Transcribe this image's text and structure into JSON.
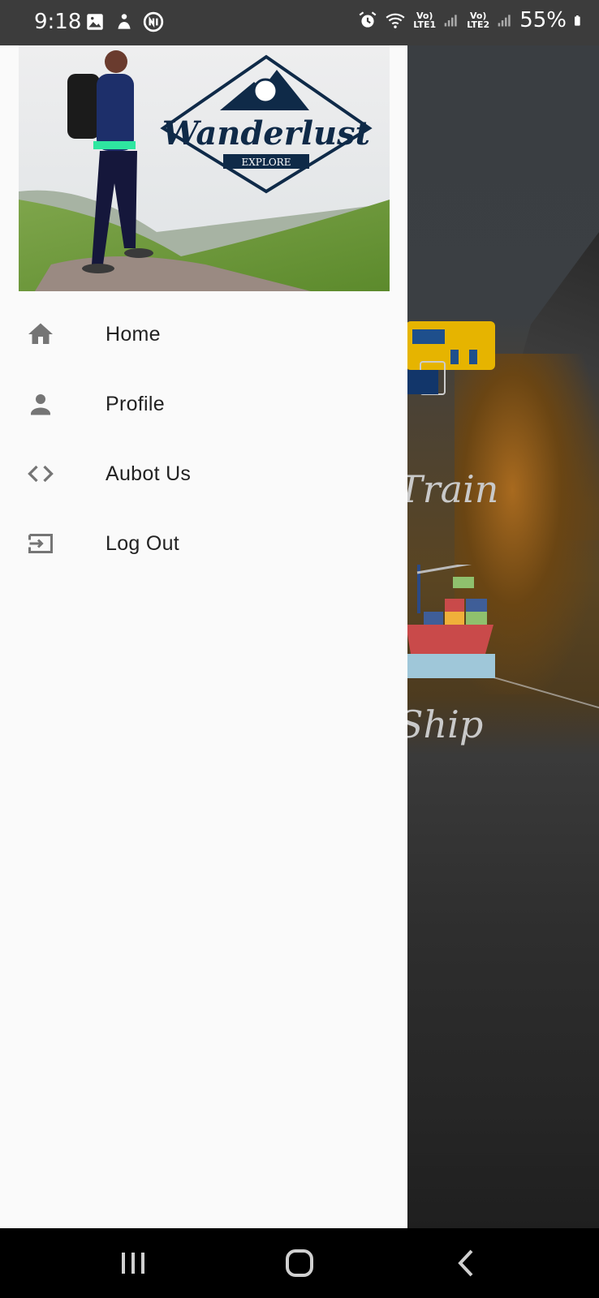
{
  "status_bar": {
    "time": "9:18",
    "battery": "55%",
    "lte1": "Vo) LTE1",
    "lte2": "Vo) LTE2",
    "left_icons": [
      "image-icon",
      "notification-icon",
      "app-icon"
    ],
    "right_icons": [
      "alarm-icon",
      "wifi-icon",
      "signal-icon",
      "battery-icon"
    ]
  },
  "drawer": {
    "logo_text": "Wanderlust",
    "logo_ribbon": "EXPLORE",
    "items": [
      {
        "label": "Home",
        "icon": "home-icon"
      },
      {
        "label": "Profile",
        "icon": "person-icon"
      },
      {
        "label": "Aubot Us",
        "icon": "code-icon"
      },
      {
        "label": "Log Out",
        "icon": "logout-icon"
      }
    ]
  },
  "background": {
    "categories": [
      "Train",
      "Ship"
    ]
  },
  "colors": {
    "drawer_bg": "#fafafa",
    "icon_gray": "#757575",
    "logo_navy": "#0f2a48",
    "status_bar": "#3c3c3c"
  },
  "nav_bar": {
    "buttons": [
      "recent-apps-icon",
      "home-nav-icon",
      "back-icon"
    ]
  }
}
